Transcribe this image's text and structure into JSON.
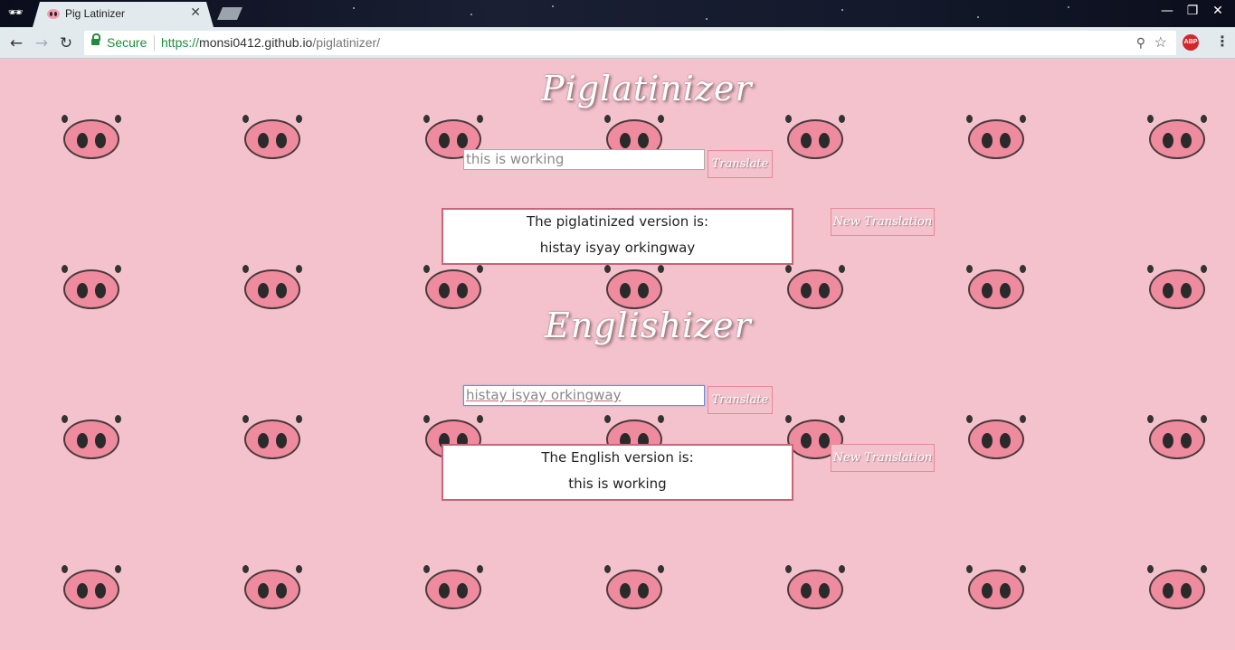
{
  "browser": {
    "tab_title": "Pig Latinizer",
    "tab_close": "✕",
    "secure_label": "Secure",
    "url_scheme": "https://",
    "url_host": "monsi0412.github.io",
    "url_path": "/piglatinizer/",
    "abp_label": "ABP",
    "icons": [
      "incognito-icon",
      "back-icon",
      "forward-icon",
      "reload-icon",
      "lock-icon",
      "zoom-icon",
      "star-icon",
      "menu-icon",
      "minimize-icon",
      "maximize-icon",
      "close-icon"
    ]
  },
  "piglatinizer": {
    "heading": "Piglatinizer",
    "input_value": "this is working",
    "translate_label": "Translate",
    "result_title": "The piglatinized version is:",
    "result_text": "histay isyay orkingway",
    "new_translation_label": "New Translation"
  },
  "englishizer": {
    "heading": "Englishizer",
    "input_value": "histay isyay orkingway",
    "translate_label": "Translate",
    "result_title": "The English version is:",
    "result_text": "this is working",
    "new_translation_label": "New Translation"
  },
  "colors": {
    "background": "#f4c2cc",
    "snout": "#ef8b9e",
    "result_border": "#c9647a",
    "button_border": "#e88898"
  }
}
